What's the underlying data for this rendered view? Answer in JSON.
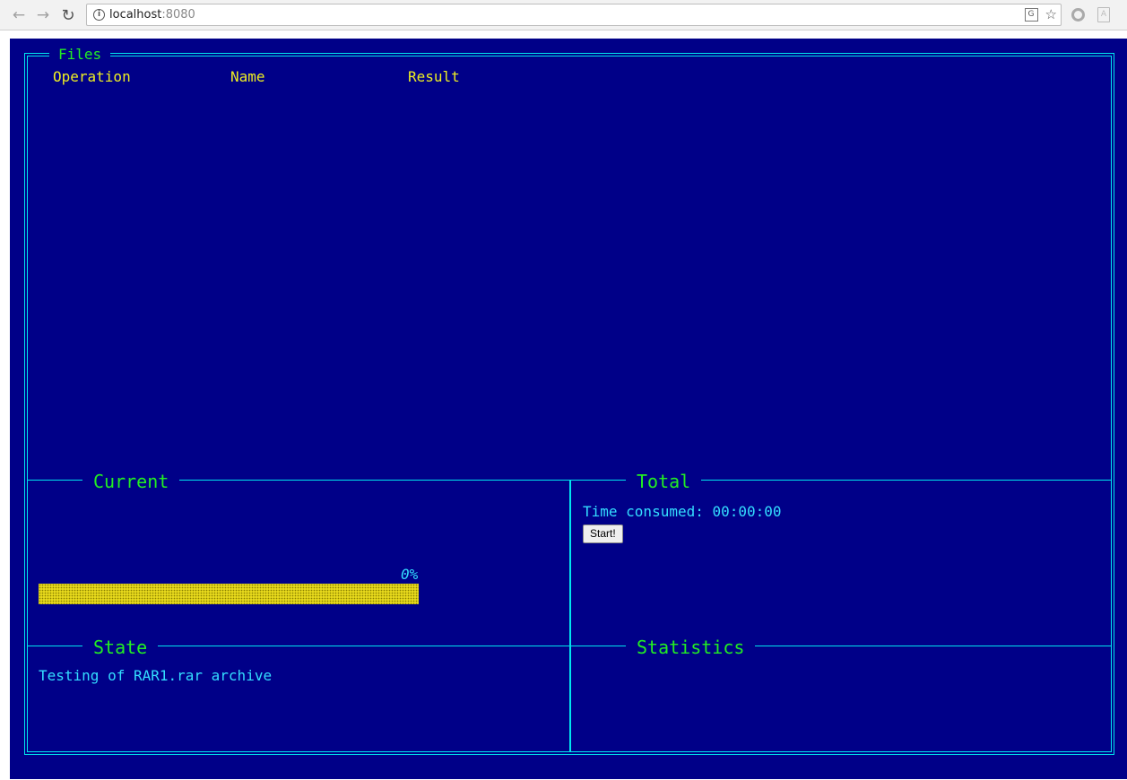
{
  "browser": {
    "url_host": "localhost",
    "url_port": ":8080",
    "back_icon": "back-arrow-icon",
    "forward_icon": "forward-arrow-icon",
    "reload_icon": "reload-icon"
  },
  "files_panel": {
    "title": "Files",
    "columns": [
      "Operation",
      "Name",
      "Result"
    ],
    "rows": []
  },
  "current_panel": {
    "title": "Current",
    "progress_percent_label": "0%",
    "progress_fraction": 0.0
  },
  "total_panel": {
    "title": "Total",
    "time_consumed_label": "Time consumed:",
    "time_consumed_value": "00:00:00",
    "start_button_label": "Start!"
  },
  "state_panel": {
    "title": "State",
    "message": "Testing of RAR1.rar archive"
  },
  "statistics_panel": {
    "title": "Statistics"
  },
  "colors": {
    "background": "#000088",
    "border": "#00e5ee",
    "title_text": "#22ee22",
    "column_header_text": "#eeee22",
    "body_text": "#33ddff",
    "progress_bar": "#e6d81c"
  }
}
